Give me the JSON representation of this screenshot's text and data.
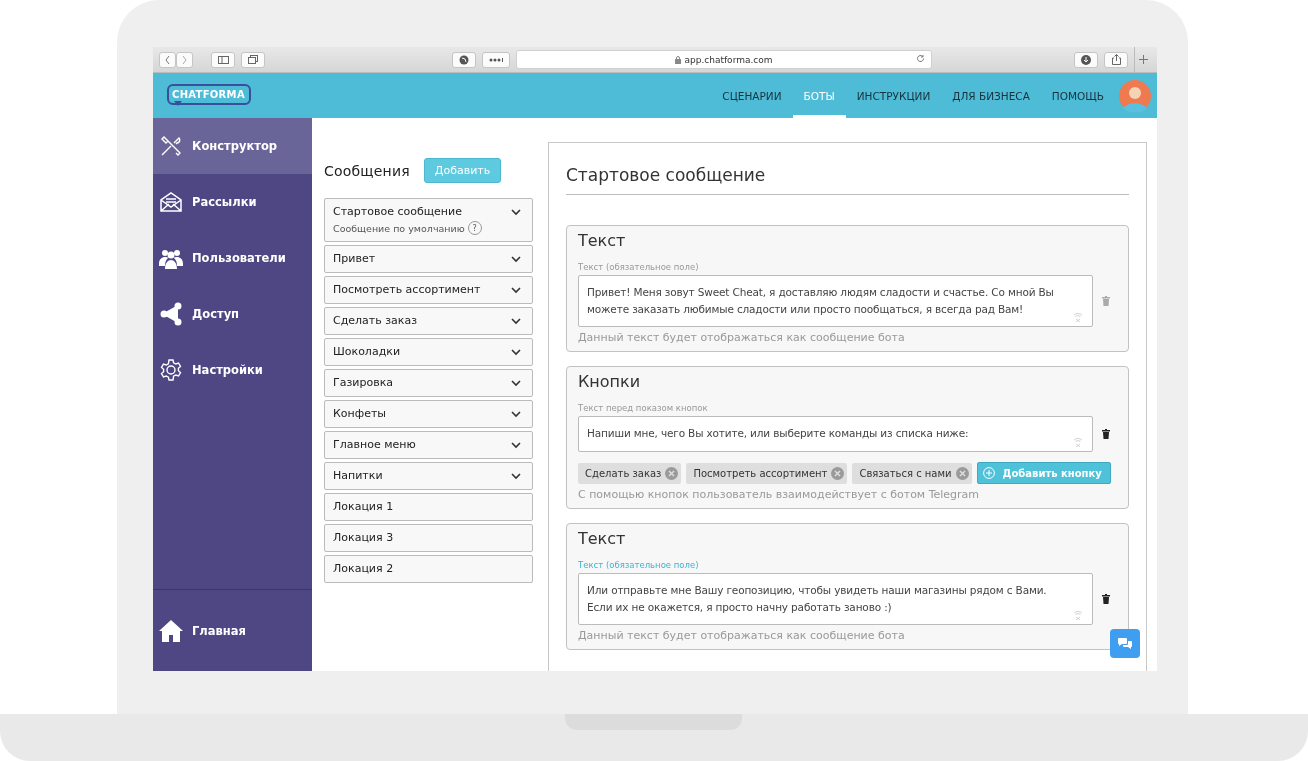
{
  "browser": {
    "url": "app.chatforma.com"
  },
  "header": {
    "logo": "CHATFORMA",
    "nav": [
      {
        "label": "СЦЕНАРИИ",
        "selected": false
      },
      {
        "label": "БОТЫ",
        "selected": true
      },
      {
        "label": "ИНСТРУКЦИИ",
        "selected": false
      },
      {
        "label": "ДЛЯ БИЗНЕСА",
        "selected": false
      },
      {
        "label": "ПОМОЩЬ",
        "selected": false
      }
    ]
  },
  "sidebar": {
    "items": [
      {
        "label": "Конструктор",
        "selected": true
      },
      {
        "label": "Рассылки",
        "selected": false
      },
      {
        "label": "Пользователи",
        "selected": false
      },
      {
        "label": "Доступ",
        "selected": false
      },
      {
        "label": "Настройки",
        "selected": false
      }
    ],
    "footer_item": {
      "label": "Главная",
      "selected": false
    }
  },
  "messages": {
    "title": "Сообщения",
    "add_button": "Добавить",
    "items": [
      {
        "label": "Стартовое сообщение",
        "subtitle": "Сообщение по умолчанию",
        "help_mark": "?",
        "expandable": true
      },
      {
        "label": "Привет",
        "expandable": true
      },
      {
        "label": "Посмотреть ассортимент",
        "expandable": true
      },
      {
        "label": "Сделать заказ",
        "expandable": true
      },
      {
        "label": "Шоколадки",
        "expandable": true
      },
      {
        "label": "Газировка",
        "expandable": true
      },
      {
        "label": "Конфеты",
        "expandable": true
      },
      {
        "label": "Главное меню",
        "expandable": true
      },
      {
        "label": "Напитки",
        "expandable": true
      },
      {
        "label": "Локация 1",
        "expandable": false
      },
      {
        "label": "Локация 3",
        "expandable": false
      },
      {
        "label": "Локация 2",
        "expandable": false
      }
    ]
  },
  "editor": {
    "title": "Стартовое сообщение",
    "sections": [
      {
        "kind": "text",
        "title": "Текст",
        "field_label": "Текст (обязательное поле)",
        "focused": false,
        "value": "Привет! Меня зовут Sweet Cheat, я доставляю людям сладости и счастье. Со мной Вы можете заказать любимые сладости или просто пообщаться, я всегда рад Вам!",
        "hint": "Данный текст будет отображаться как сообщение бота"
      },
      {
        "kind": "buttons",
        "title": "Кнопки",
        "field_label": "Текст перед показом кнопок",
        "focused": false,
        "value": "Напиши мне, чего Вы хотите, или выберите команды из списка ниже:",
        "chips": [
          "Сделать заказ",
          "Посмотреть ассортимент",
          "Связаться с нами"
        ],
        "add_button": "Добавить кнопку",
        "hint": "С помощью кнопок пользователь взаимодействует с ботом Telegram"
      },
      {
        "kind": "text",
        "title": "Текст",
        "field_label": "Текст (обязательное поле)",
        "focused": true,
        "value": "Или отправьте мне Вашу геопозицию, чтобы увидеть наши магазины рядом с Вами. Если их не окажется, я просто начну работать заново :)",
        "hint": "Данный текст будет отображаться как сообщение бота"
      }
    ]
  }
}
